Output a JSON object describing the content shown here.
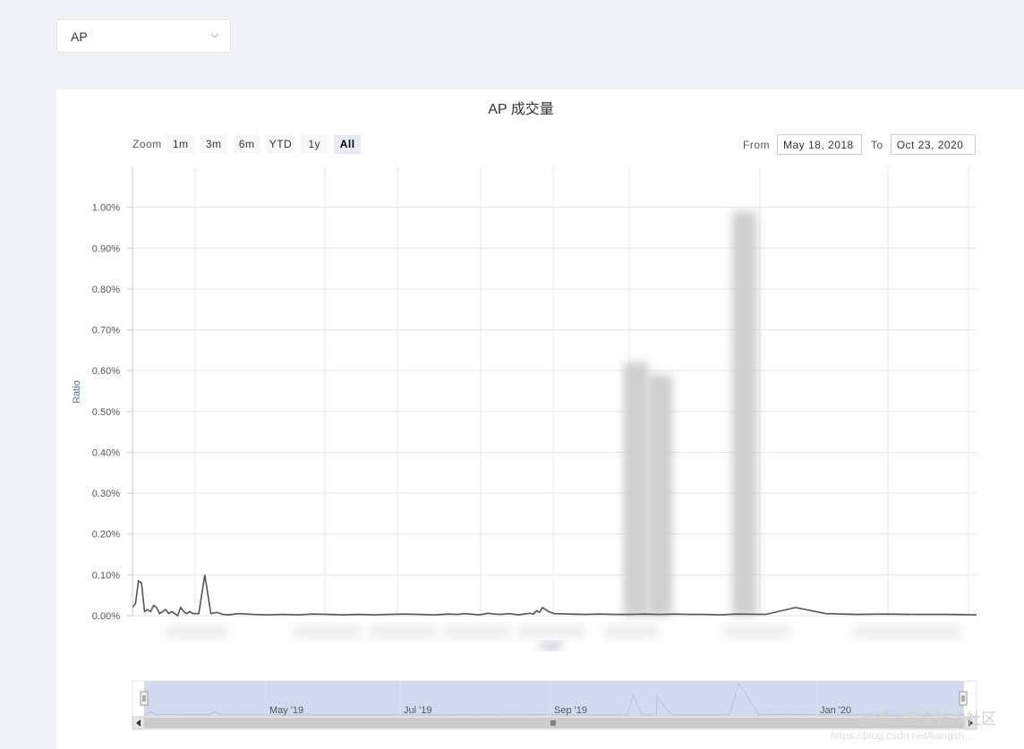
{
  "selector": {
    "value": "AP"
  },
  "zoom": {
    "label": "Zoom",
    "buttons": [
      "1m",
      "3m",
      "6m",
      "YTD",
      "1y",
      "All"
    ],
    "active": "All"
  },
  "range": {
    "from_label": "From",
    "from_value": "May 18, 2018",
    "to_label": "To",
    "to_value": "Oct 23, 2020"
  },
  "navigator": {
    "labels": [
      "May '19",
      "Jul '19",
      "Sep '19",
      "Jan '20"
    ]
  },
  "watermark": {
    "text": "@稀土掘金技术社区",
    "url": "https://blog.csdn.net/tiangsh..."
  },
  "colors": {
    "line": "#555555",
    "navigator_mask": "#c9d3ec",
    "grid": "#e6e6e6"
  },
  "chart_data": {
    "type": "line",
    "title": "AP 成交量",
    "ylabel": "Ratio",
    "xlabel": "",
    "ylim": [
      0,
      1.1
    ],
    "yticks": [
      "0.00%",
      "0.10%",
      "0.20%",
      "0.30%",
      "0.40%",
      "0.50%",
      "0.60%",
      "0.70%",
      "0.80%",
      "0.90%",
      "1.00%"
    ],
    "grid": true,
    "series": [
      {
        "name": "",
        "x": [
          0,
          1,
          2,
          3,
          4,
          5,
          6,
          7,
          8,
          9,
          10,
          11,
          12,
          13,
          14,
          15,
          16,
          17,
          18,
          19,
          20,
          22,
          24,
          26,
          28,
          30,
          32,
          35,
          40,
          45,
          50,
          55,
          60,
          65,
          70,
          75,
          80,
          85,
          90,
          95,
          100,
          105,
          108,
          110,
          112,
          115,
          118,
          120,
          122,
          125,
          128,
          130,
          132,
          133,
          134,
          135,
          136,
          138,
          140,
          145,
          150,
          155,
          160,
          165,
          170,
          175,
          180,
          185,
          190,
          195,
          200,
          210,
          220,
          230,
          240,
          250,
          260,
          270,
          280
        ],
        "values": [
          0.02,
          0.03,
          0.085,
          0.08,
          0.01,
          0.015,
          0.01,
          0.025,
          0.02,
          0.005,
          0.01,
          0.015,
          0.005,
          0.01,
          0.005,
          0.0,
          0.02,
          0.01,
          0.005,
          0.01,
          0.005,
          0.005,
          0.1,
          0.005,
          0.008,
          0.003,
          0.002,
          0.005,
          0.003,
          0.002,
          0.003,
          0.002,
          0.004,
          0.003,
          0.002,
          0.003,
          0.002,
          0.003,
          0.004,
          0.003,
          0.002,
          0.004,
          0.003,
          0.005,
          0.004,
          0.002,
          0.006,
          0.004,
          0.003,
          0.005,
          0.002,
          0.004,
          0.006,
          0.004,
          0.012,
          0.008,
          0.02,
          0.01,
          0.005,
          0.004,
          0.003,
          0.004,
          0.003,
          0.003,
          0.004,
          0.003,
          0.004,
          0.003,
          0.003,
          0.002,
          0.004,
          0.003,
          0.02,
          0.005,
          0.003,
          0.004,
          0.003,
          0.003,
          0.002
        ]
      }
    ],
    "blurred_bars": [
      {
        "x": 167,
        "value": 0.62
      },
      {
        "x": 175,
        "value": 0.59
      },
      {
        "x": 203,
        "value": 0.99
      }
    ]
  }
}
